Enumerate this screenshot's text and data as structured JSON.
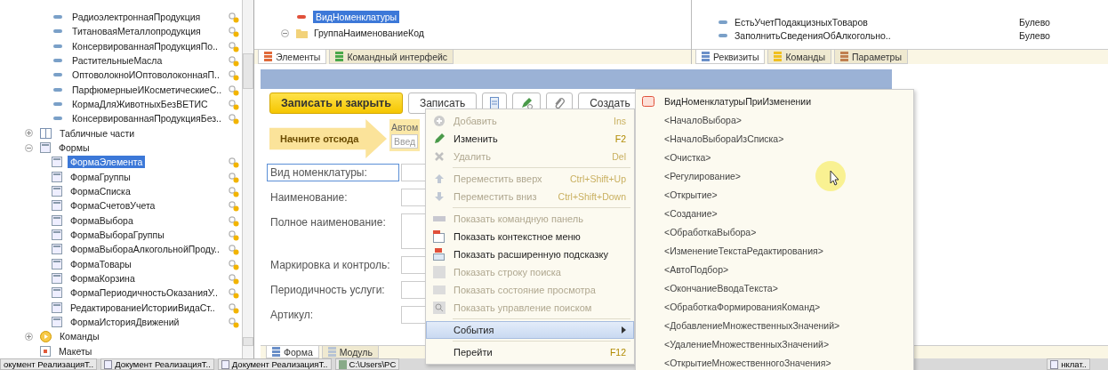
{
  "object_tree": {
    "attribute_items": [
      {
        "label": "РадиоэлектроннаяПродукция",
        "selected": false
      },
      {
        "label": "ТитановаяМеталлопродукция",
        "selected": false
      },
      {
        "label": "КонсервированнаяПродукцияПо..",
        "selected": false
      },
      {
        "label": "РастительныеМасла",
        "selected": false
      },
      {
        "label": "ОптоволокноИОптоволоконнаяП..",
        "selected": false
      },
      {
        "label": "ПарфюмерныеИКосметическиеС..",
        "selected": false
      },
      {
        "label": "КормаДляЖивотныхБезВЕТИС",
        "selected": false
      },
      {
        "label": "КонсервированнаяПродукцияБез..",
        "selected": false
      }
    ],
    "nodes": [
      {
        "label": "Табличные части",
        "kind": "tabular",
        "expanded": false
      },
      {
        "label": "Формы",
        "kind": "forms",
        "expanded": true,
        "children": [
          {
            "label": "ФормаЭлемента",
            "selected": true
          },
          {
            "label": "ФормаГруппы",
            "selected": false
          },
          {
            "label": "ФормаСписка",
            "selected": false
          },
          {
            "label": "ФормаСчетовУчета",
            "selected": false
          },
          {
            "label": "ФормаВыбора",
            "selected": false
          },
          {
            "label": "ФормаВыбораГруппы",
            "selected": false
          },
          {
            "label": "ФормаВыбораАлкогольнойПроду..",
            "selected": false
          },
          {
            "label": "ФормаТовары",
            "selected": false
          },
          {
            "label": "ФормаКорзина",
            "selected": false
          },
          {
            "label": "ФормаПериодичностьОказанияУ..",
            "selected": false
          },
          {
            "label": "РедактированиеИсторииВидаСт..",
            "selected": false
          },
          {
            "label": "ФормаИсторияДвижений",
            "selected": false
          }
        ]
      },
      {
        "label": "Команды",
        "kind": "commands",
        "expanded": false
      },
      {
        "label": "Макеты",
        "kind": "templates"
      }
    ]
  },
  "element_tree": {
    "items": [
      {
        "label": "ВидНоменклатуры",
        "kind": "field",
        "selected": true
      },
      {
        "label": "ГруппаНаименованиеКод",
        "kind": "group",
        "selected": false,
        "expanded": true
      }
    ],
    "tabs": [
      {
        "label": "Элементы",
        "kind": "elements",
        "selected": true
      },
      {
        "label": "Командный интерфейс",
        "kind": "interface",
        "selected": false
      }
    ]
  },
  "attributes": {
    "rows": [
      {
        "name": "ЕстьУчетПодакцизныхТоваров",
        "type": "Булево"
      },
      {
        "name": "ЗаполнитьСведенияОбАлкогольно..",
        "type": "Булево"
      }
    ],
    "tabs": [
      {
        "label": "Реквизиты",
        "kind": "attributes",
        "selected": true
      },
      {
        "label": "Команды",
        "kind": "commands",
        "selected": false
      },
      {
        "label": "Параметры",
        "kind": "parameters",
        "selected": false
      }
    ]
  },
  "form_preview": {
    "buttons": [
      {
        "kind": "primary",
        "label": "Записать и закрыть"
      },
      {
        "kind": "text",
        "label": "Записать"
      },
      {
        "kind": "list"
      },
      {
        "kind": "pen"
      },
      {
        "kind": "clip"
      },
      {
        "kind": "text",
        "label": "Создать"
      }
    ],
    "hint": "Начните отсюда",
    "auto_box": {
      "label": "Автом",
      "placeholder": "Введ"
    },
    "fields": [
      {
        "label": "Вид номенклатуры:",
        "focused": true,
        "tall": false
      },
      {
        "label": "Наименование:",
        "focused": false,
        "tall": false
      },
      {
        "label": "Полное наименование:",
        "focused": false,
        "tall": true
      },
      {
        "label": "Маркировка и контроль:",
        "focused": false,
        "tall": false
      },
      {
        "label": "Периодичность услуги:",
        "focused": false,
        "tall": false
      },
      {
        "label": "Артикул:",
        "focused": false,
        "tall": false
      }
    ],
    "tabs": [
      {
        "label": "Форма",
        "kind": "form",
        "selected": true
      },
      {
        "label": "Модуль",
        "kind": "module",
        "selected": false
      }
    ]
  },
  "context_menu": {
    "groups": [
      [
        {
          "label": "Добавить",
          "shortcut": "Ins",
          "kind": "add",
          "disabled": true
        },
        {
          "label": "Изменить",
          "shortcut": "F2",
          "kind": "edit",
          "disabled": false
        },
        {
          "label": "Удалить",
          "shortcut": "Del",
          "kind": "delete",
          "disabled": true
        }
      ],
      [
        {
          "label": "Переместить вверх",
          "shortcut": "Ctrl+Shift+Up",
          "kind": "up",
          "disabled": true
        },
        {
          "label": "Переместить вниз",
          "shortcut": "Ctrl+Shift+Down",
          "kind": "down",
          "disabled": true
        }
      ],
      [
        {
          "label": "Показать командную панель",
          "kind": "bar",
          "disabled": true
        },
        {
          "label": "Показать контекстное меню",
          "kind": "menu",
          "disabled": false
        },
        {
          "label": "Показать расширенную подсказку",
          "kind": "tip",
          "disabled": false
        },
        {
          "label": "Показать строку поиска",
          "kind": "searchbar",
          "disabled": true
        },
        {
          "label": "Показать состояние просмотра",
          "kind": "state",
          "disabled": true
        },
        {
          "label": "Показать управление поиском",
          "kind": "search",
          "disabled": true
        }
      ],
      [
        {
          "label": "События",
          "submenu": true,
          "selected": true,
          "disabled": false
        }
      ],
      [
        {
          "label": "Перейти",
          "shortcut": "F12",
          "disabled": false,
          "selected": false
        }
      ]
    ]
  },
  "events_submenu": {
    "items": [
      {
        "label": "ВидНоменклатурыПриИзменении",
        "kind": "assigned"
      },
      {
        "label": "<НачалоВыбора>",
        "kind": "empty"
      },
      {
        "label": "<НачалоВыбораИзСписка>",
        "kind": "empty"
      },
      {
        "label": "<Очистка>",
        "kind": "empty"
      },
      {
        "label": "<Регулирование>",
        "kind": "empty"
      },
      {
        "label": "<Открытие>",
        "kind": "empty"
      },
      {
        "label": "<Создание>",
        "kind": "empty"
      },
      {
        "label": "<ОбработкаВыбора>",
        "kind": "empty"
      },
      {
        "label": "<ИзменениеТекстаРедактирования>",
        "kind": "empty"
      },
      {
        "label": "<АвтоПодбор>",
        "kind": "empty"
      },
      {
        "label": "<ОкончаниеВводаТекста>",
        "kind": "empty"
      },
      {
        "label": "<ОбработкаФормированияКоманд>",
        "kind": "empty"
      },
      {
        "label": "<ДобавлениеМножественныхЗначений>",
        "kind": "empty"
      },
      {
        "label": "<УдалениеМножественныхЗначений>",
        "kind": "empty"
      },
      {
        "label": "<ОткрытиеМножественногоЗначения>",
        "kind": "empty"
      }
    ]
  },
  "taskbar": {
    "items": [
      {
        "label": "окумент РеализацияТ..",
        "kind": "form"
      },
      {
        "label": "Документ РеализацияТ..",
        "kind": "form"
      },
      {
        "label": "Документ РеализацияТ..",
        "kind": "form"
      },
      {
        "label": "C:\\Users\\PC",
        "kind": "file"
      },
      {
        "label": "нклат..",
        "kind": "form"
      }
    ]
  }
}
